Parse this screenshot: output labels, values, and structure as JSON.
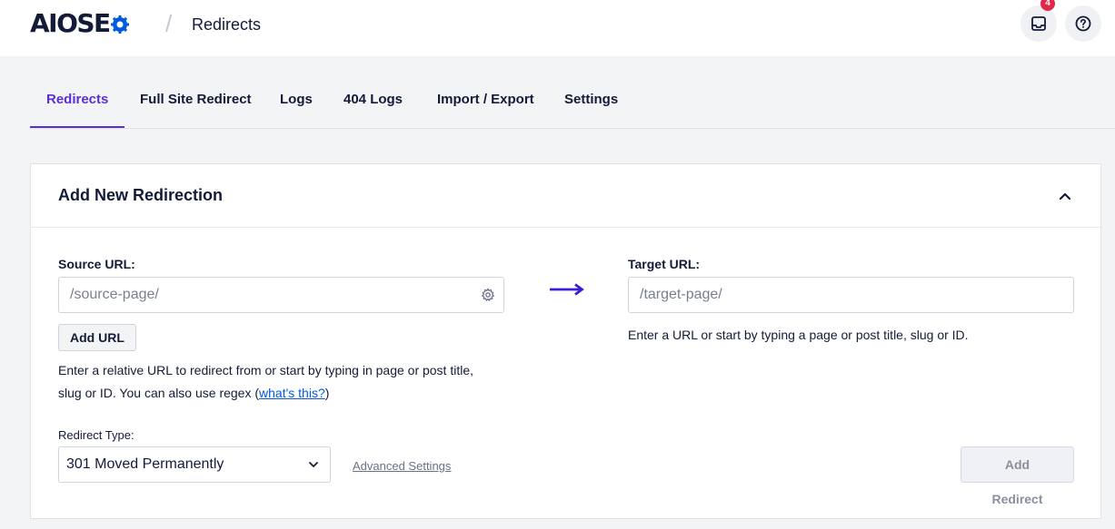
{
  "header": {
    "logo_main": "AIOSE",
    "logo_suffix_icon": "gear-o-icon",
    "breadcrumb_separator": "/",
    "page_title": "Redirects",
    "notifications_count": "4",
    "inbox_icon": "inbox-icon",
    "help_icon": "help-icon"
  },
  "tabs": [
    {
      "label": "Redirects",
      "active": true
    },
    {
      "label": "Full Site Redirect",
      "active": false
    },
    {
      "label": "Logs",
      "active": false
    },
    {
      "label": "404 Logs",
      "active": false
    },
    {
      "label": "Import / Export",
      "active": false
    },
    {
      "label": "Settings",
      "active": false
    }
  ],
  "card": {
    "title": "Add New Redirection",
    "collapse_icon": "chevron-up-icon",
    "source": {
      "label": "Source URL:",
      "placeholder": "/source-page/",
      "value": "",
      "add_url_label": "Add URL",
      "help_line1": "Enter a relative URL to redirect from or start by typing in page or post title,",
      "help_line2_prefix": "slug or ID. You can also use regex (",
      "help_link": "what's this?",
      "help_line2_suffix": ")"
    },
    "target": {
      "label": "Target URL:",
      "placeholder": "/target-page/",
      "value": "",
      "help": "Enter a URL or start by typing a page or post title, slug or ID."
    },
    "redirect_type": {
      "label": "Redirect Type:",
      "selected": "301 Moved Permanently"
    },
    "advanced_settings_label": "Advanced Settings",
    "add_redirect_label": "Add Redirect"
  },
  "colors": {
    "accent": "#5c2fd4",
    "brand_blue": "#005ae0",
    "badge": "#df2a4a",
    "background": "#f3f4f6"
  }
}
